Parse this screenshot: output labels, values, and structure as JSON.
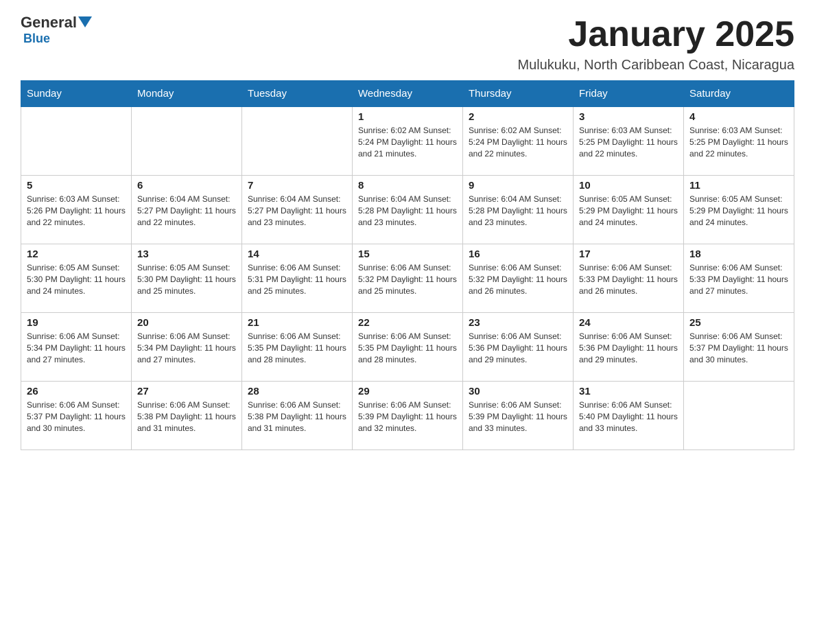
{
  "header": {
    "logo_general": "General",
    "logo_blue": "Blue",
    "title": "January 2025",
    "subtitle": "Mulukuku, North Caribbean Coast, Nicaragua"
  },
  "calendar": {
    "days_of_week": [
      "Sunday",
      "Monday",
      "Tuesday",
      "Wednesday",
      "Thursday",
      "Friday",
      "Saturday"
    ],
    "weeks": [
      {
        "days": [
          {
            "number": "",
            "info": ""
          },
          {
            "number": "",
            "info": ""
          },
          {
            "number": "",
            "info": ""
          },
          {
            "number": "1",
            "info": "Sunrise: 6:02 AM\nSunset: 5:24 PM\nDaylight: 11 hours and 21 minutes."
          },
          {
            "number": "2",
            "info": "Sunrise: 6:02 AM\nSunset: 5:24 PM\nDaylight: 11 hours and 22 minutes."
          },
          {
            "number": "3",
            "info": "Sunrise: 6:03 AM\nSunset: 5:25 PM\nDaylight: 11 hours and 22 minutes."
          },
          {
            "number": "4",
            "info": "Sunrise: 6:03 AM\nSunset: 5:25 PM\nDaylight: 11 hours and 22 minutes."
          }
        ]
      },
      {
        "days": [
          {
            "number": "5",
            "info": "Sunrise: 6:03 AM\nSunset: 5:26 PM\nDaylight: 11 hours and 22 minutes."
          },
          {
            "number": "6",
            "info": "Sunrise: 6:04 AM\nSunset: 5:27 PM\nDaylight: 11 hours and 22 minutes."
          },
          {
            "number": "7",
            "info": "Sunrise: 6:04 AM\nSunset: 5:27 PM\nDaylight: 11 hours and 23 minutes."
          },
          {
            "number": "8",
            "info": "Sunrise: 6:04 AM\nSunset: 5:28 PM\nDaylight: 11 hours and 23 minutes."
          },
          {
            "number": "9",
            "info": "Sunrise: 6:04 AM\nSunset: 5:28 PM\nDaylight: 11 hours and 23 minutes."
          },
          {
            "number": "10",
            "info": "Sunrise: 6:05 AM\nSunset: 5:29 PM\nDaylight: 11 hours and 24 minutes."
          },
          {
            "number": "11",
            "info": "Sunrise: 6:05 AM\nSunset: 5:29 PM\nDaylight: 11 hours and 24 minutes."
          }
        ]
      },
      {
        "days": [
          {
            "number": "12",
            "info": "Sunrise: 6:05 AM\nSunset: 5:30 PM\nDaylight: 11 hours and 24 minutes."
          },
          {
            "number": "13",
            "info": "Sunrise: 6:05 AM\nSunset: 5:30 PM\nDaylight: 11 hours and 25 minutes."
          },
          {
            "number": "14",
            "info": "Sunrise: 6:06 AM\nSunset: 5:31 PM\nDaylight: 11 hours and 25 minutes."
          },
          {
            "number": "15",
            "info": "Sunrise: 6:06 AM\nSunset: 5:32 PM\nDaylight: 11 hours and 25 minutes."
          },
          {
            "number": "16",
            "info": "Sunrise: 6:06 AM\nSunset: 5:32 PM\nDaylight: 11 hours and 26 minutes."
          },
          {
            "number": "17",
            "info": "Sunrise: 6:06 AM\nSunset: 5:33 PM\nDaylight: 11 hours and 26 minutes."
          },
          {
            "number": "18",
            "info": "Sunrise: 6:06 AM\nSunset: 5:33 PM\nDaylight: 11 hours and 27 minutes."
          }
        ]
      },
      {
        "days": [
          {
            "number": "19",
            "info": "Sunrise: 6:06 AM\nSunset: 5:34 PM\nDaylight: 11 hours and 27 minutes."
          },
          {
            "number": "20",
            "info": "Sunrise: 6:06 AM\nSunset: 5:34 PM\nDaylight: 11 hours and 27 minutes."
          },
          {
            "number": "21",
            "info": "Sunrise: 6:06 AM\nSunset: 5:35 PM\nDaylight: 11 hours and 28 minutes."
          },
          {
            "number": "22",
            "info": "Sunrise: 6:06 AM\nSunset: 5:35 PM\nDaylight: 11 hours and 28 minutes."
          },
          {
            "number": "23",
            "info": "Sunrise: 6:06 AM\nSunset: 5:36 PM\nDaylight: 11 hours and 29 minutes."
          },
          {
            "number": "24",
            "info": "Sunrise: 6:06 AM\nSunset: 5:36 PM\nDaylight: 11 hours and 29 minutes."
          },
          {
            "number": "25",
            "info": "Sunrise: 6:06 AM\nSunset: 5:37 PM\nDaylight: 11 hours and 30 minutes."
          }
        ]
      },
      {
        "days": [
          {
            "number": "26",
            "info": "Sunrise: 6:06 AM\nSunset: 5:37 PM\nDaylight: 11 hours and 30 minutes."
          },
          {
            "number": "27",
            "info": "Sunrise: 6:06 AM\nSunset: 5:38 PM\nDaylight: 11 hours and 31 minutes."
          },
          {
            "number": "28",
            "info": "Sunrise: 6:06 AM\nSunset: 5:38 PM\nDaylight: 11 hours and 31 minutes."
          },
          {
            "number": "29",
            "info": "Sunrise: 6:06 AM\nSunset: 5:39 PM\nDaylight: 11 hours and 32 minutes."
          },
          {
            "number": "30",
            "info": "Sunrise: 6:06 AM\nSunset: 5:39 PM\nDaylight: 11 hours and 33 minutes."
          },
          {
            "number": "31",
            "info": "Sunrise: 6:06 AM\nSunset: 5:40 PM\nDaylight: 11 hours and 33 minutes."
          },
          {
            "number": "",
            "info": ""
          }
        ]
      }
    ]
  }
}
